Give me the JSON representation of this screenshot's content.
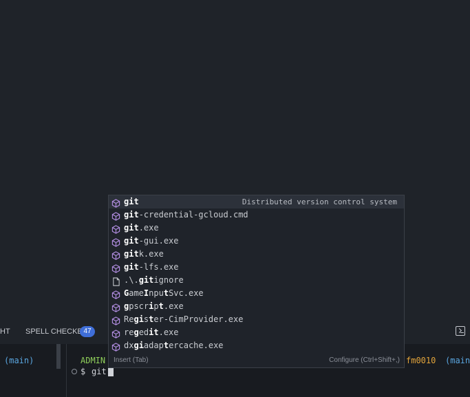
{
  "panel": {
    "tab_partial": "HT",
    "spell_checker_label": "SPELL CHECKER",
    "spell_checker_count": "47"
  },
  "terminal": {
    "left_pane_branch": "(main)",
    "right_user_partial": "ADMIN",
    "right_host_partial": "fm0010",
    "right_branch_partial": "(main",
    "prompt": "$",
    "input": "git"
  },
  "suggestions": {
    "selected_detail": "Distributed version control system",
    "footer_insert": "Insert (Tab)",
    "footer_configure": "Configure (Ctrl+Shift+,)",
    "items": [
      {
        "text": "git",
        "icon": "package-icon"
      },
      {
        "text": "git-credential-gcloud.cmd",
        "icon": "package-icon"
      },
      {
        "text": "git.exe",
        "icon": "package-icon"
      },
      {
        "text": "git-gui.exe",
        "icon": "package-icon"
      },
      {
        "text": "gitk.exe",
        "icon": "package-icon"
      },
      {
        "text": "git-lfs.exe",
        "icon": "package-icon"
      },
      {
        "text": ".\\.gitignore",
        "icon": "file-icon"
      },
      {
        "text": "GameInputSvc.exe",
        "icon": "package-icon"
      },
      {
        "text": "gpscript.exe",
        "icon": "package-icon"
      },
      {
        "text": "Register-CimProvider.exe",
        "icon": "package-icon"
      },
      {
        "text": "regedit.exe",
        "icon": "package-icon"
      },
      {
        "text": "dxgiadaptercache.exe",
        "icon": "package-icon"
      }
    ]
  }
}
